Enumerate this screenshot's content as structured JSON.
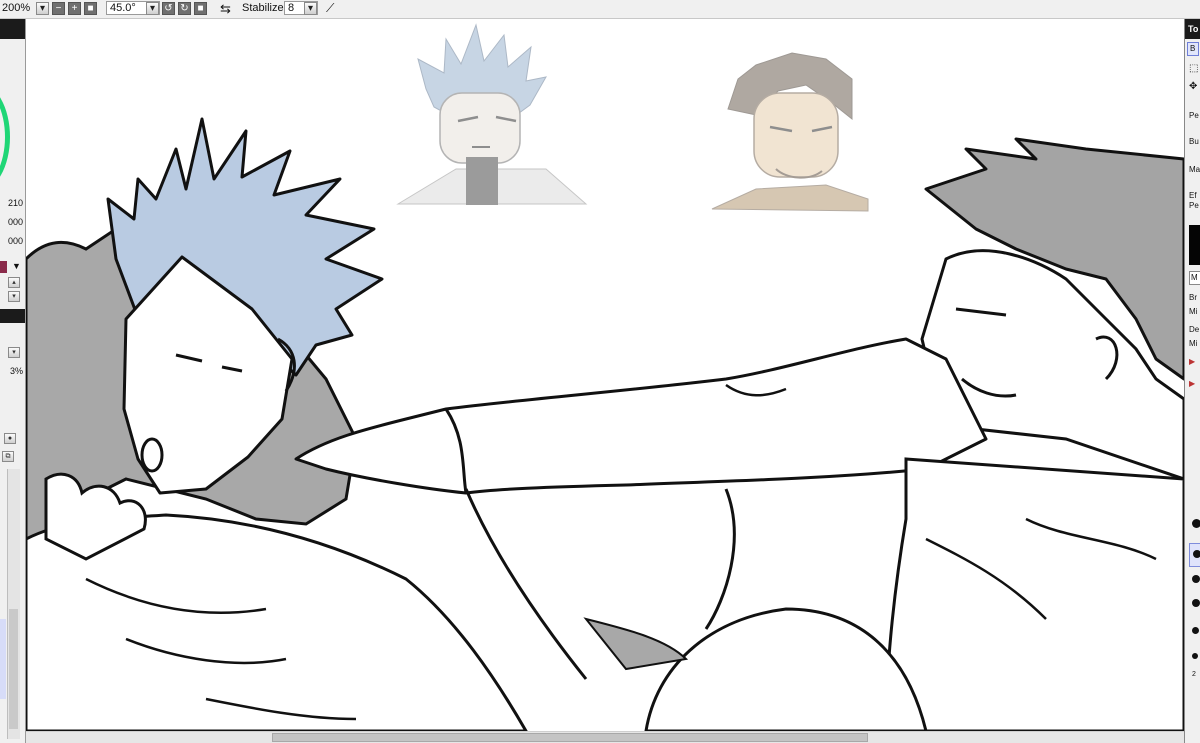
{
  "toolbar": {
    "zoom_value": "200%",
    "zoom_minus": "−",
    "zoom_plus": "+",
    "rotation_value": "45.0°",
    "stabilizer_label": "Stabilizer",
    "stabilizer_value": "8"
  },
  "left_panel": {
    "values": [
      "210",
      "000",
      "000"
    ],
    "percent_value": "3%"
  },
  "right_panel": {
    "title": "To",
    "tab_label": "B",
    "labels": [
      "Pe",
      "Bu",
      "Ma",
      "Ef",
      "Pe"
    ],
    "mode_label": "M",
    "bottom_labels": [
      "Br",
      "Mi",
      "De",
      "Mi"
    ],
    "brush_sizes": [
      "",
      "",
      "",
      "",
      "",
      "",
      "2"
    ]
  },
  "canvas": {
    "subject": "line-art illustration of two men"
  },
  "colors": {
    "accent": "#3b6fd6",
    "hair_blue": "#b9cbe2",
    "hair_grey": "#a4a4a4",
    "jacket_grey": "#a8a8a8",
    "color_wheel_green": "#1fd676"
  }
}
